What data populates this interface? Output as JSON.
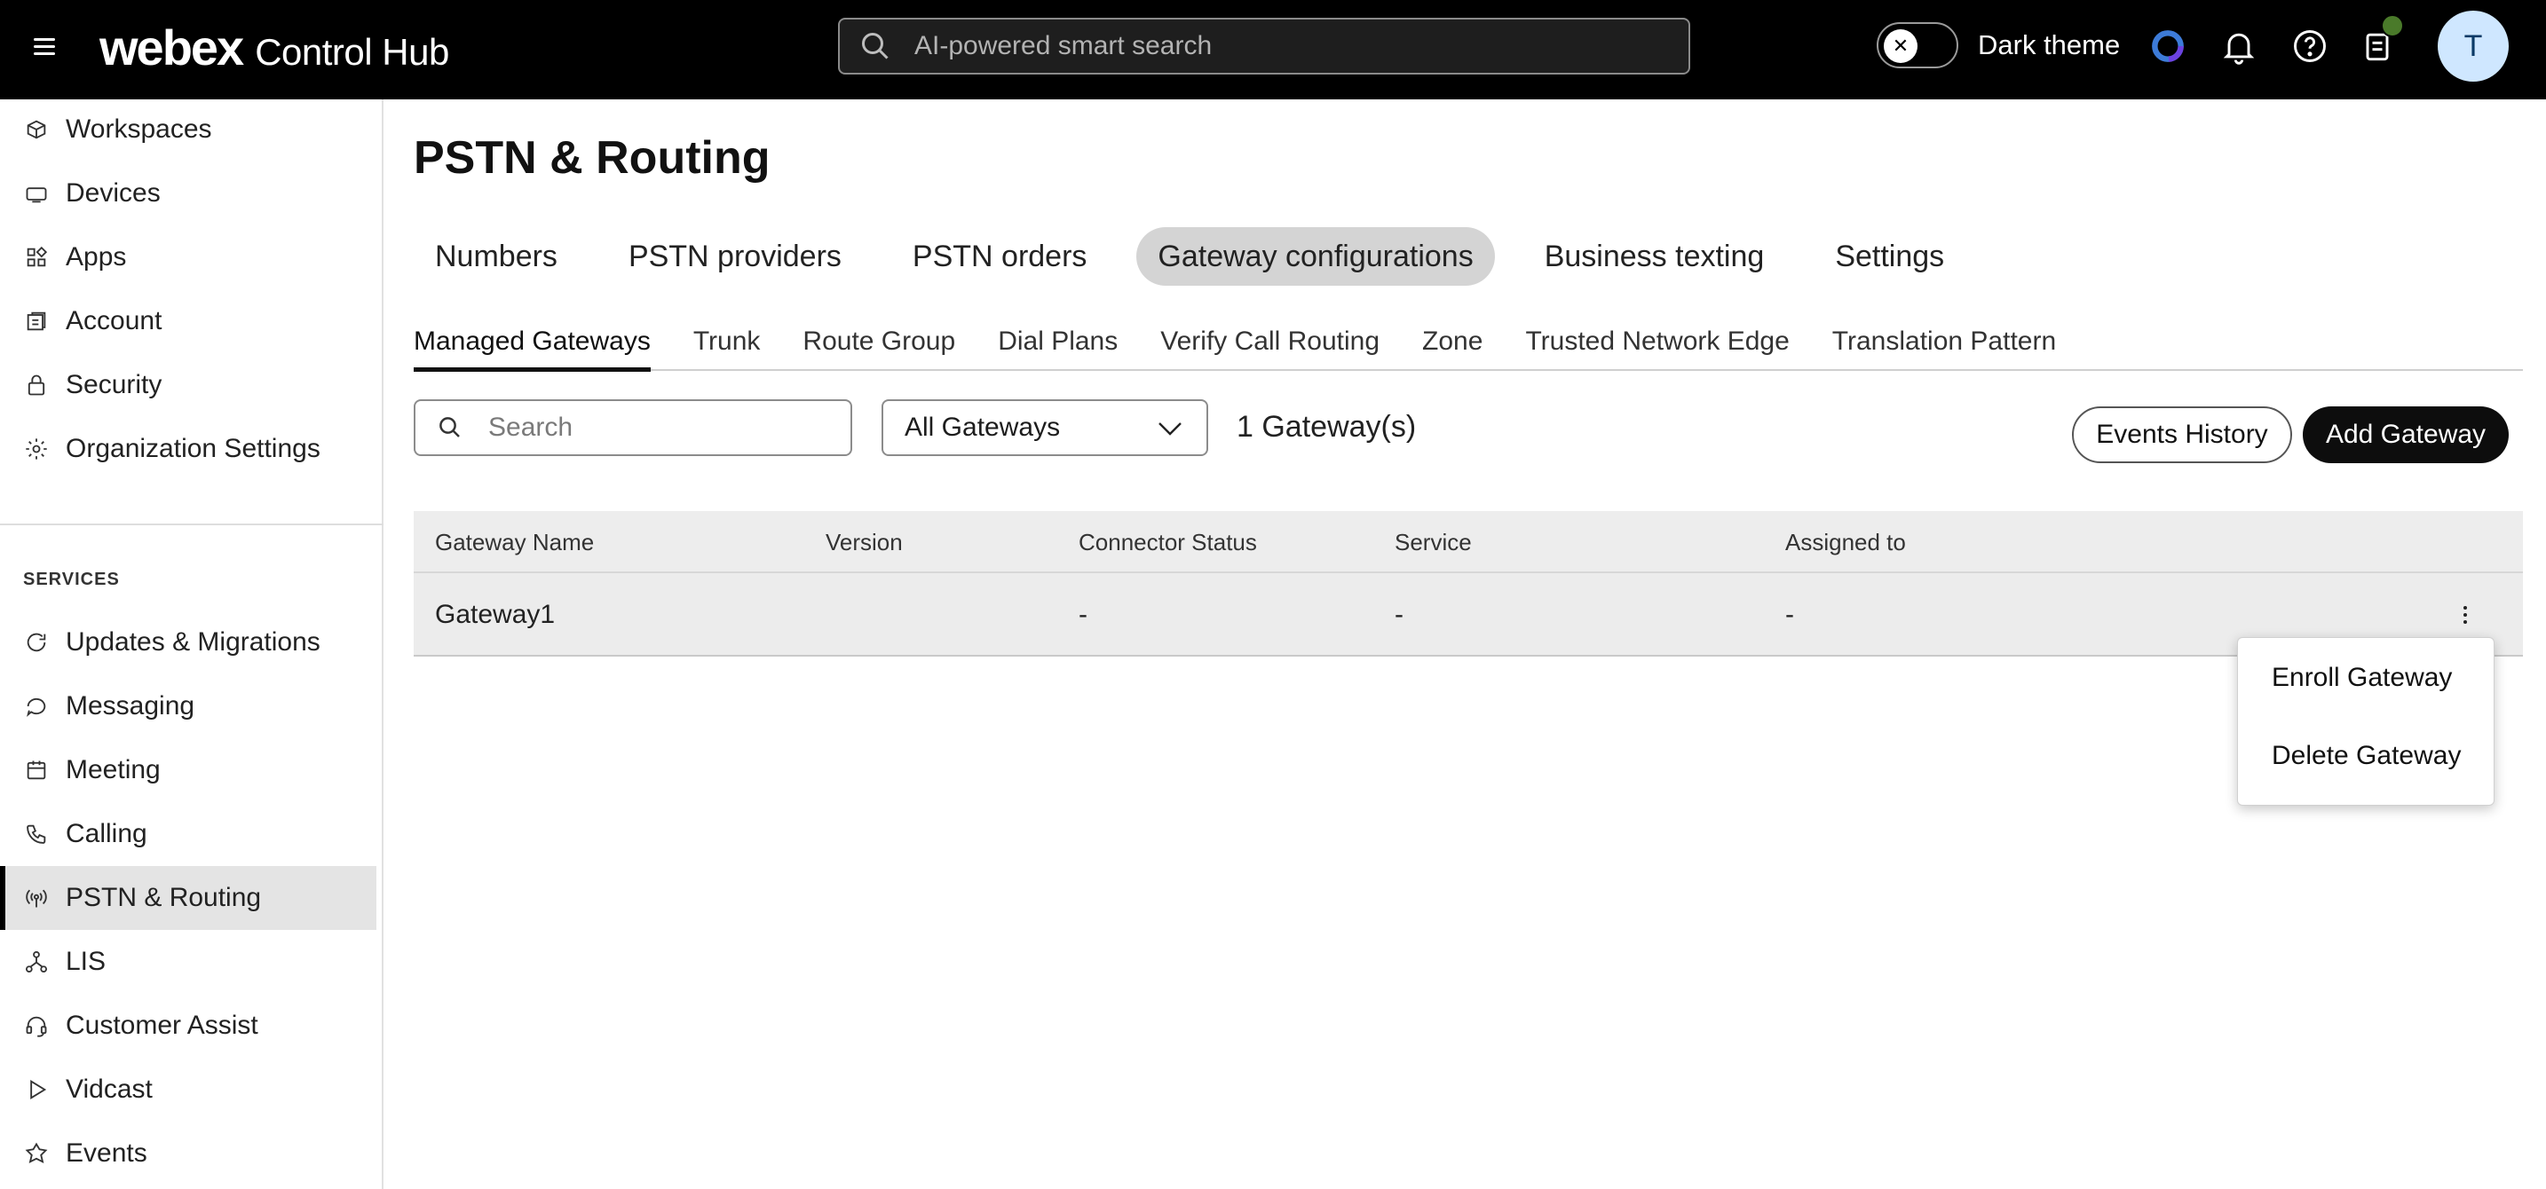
{
  "app": {
    "logo": "webex",
    "product": "Control Hub"
  },
  "header": {
    "search_placeholder": "AI-powered smart search",
    "theme_label": "Dark theme",
    "avatar_initial": "T",
    "icons": [
      "menu-icon",
      "search-icon",
      "toggle-close-icon",
      "webex-ai-icon",
      "bell-icon",
      "help-icon",
      "clipboard-icon"
    ]
  },
  "sidebar": {
    "items": [
      {
        "label": "Workspaces",
        "icon": "workspace-icon"
      },
      {
        "label": "Devices",
        "icon": "device-icon"
      },
      {
        "label": "Apps",
        "icon": "apps-icon"
      },
      {
        "label": "Account",
        "icon": "account-icon"
      },
      {
        "label": "Security",
        "icon": "lock-icon"
      },
      {
        "label": "Organization Settings",
        "icon": "gear-icon"
      }
    ],
    "section_label": "SERVICES",
    "services": [
      {
        "label": "Updates & Migrations",
        "icon": "refresh-icon"
      },
      {
        "label": "Messaging",
        "icon": "chat-icon"
      },
      {
        "label": "Meeting",
        "icon": "calendar-icon"
      },
      {
        "label": "Calling",
        "icon": "phone-icon"
      },
      {
        "label": "PSTN & Routing",
        "icon": "antenna-icon",
        "active": true
      },
      {
        "label": "LIS",
        "icon": "network-icon"
      },
      {
        "label": "Customer Assist",
        "icon": "headset-icon"
      },
      {
        "label": "Vidcast",
        "icon": "play-icon"
      },
      {
        "label": "Events",
        "icon": "events-icon"
      }
    ]
  },
  "main": {
    "title": "PSTN & Routing",
    "tabs": [
      {
        "label": "Numbers"
      },
      {
        "label": "PSTN providers"
      },
      {
        "label": "PSTN orders"
      },
      {
        "label": "Gateway configurations",
        "active": true
      },
      {
        "label": "Business texting"
      },
      {
        "label": "Settings"
      }
    ],
    "subtabs": [
      {
        "label": "Managed Gateways",
        "active": true
      },
      {
        "label": "Trunk"
      },
      {
        "label": "Route Group"
      },
      {
        "label": "Dial Plans"
      },
      {
        "label": "Verify Call Routing"
      },
      {
        "label": "Zone"
      },
      {
        "label": "Trusted Network Edge"
      },
      {
        "label": "Translation Pattern"
      }
    ],
    "search_placeholder": "Search",
    "filter_selected": "All Gateways",
    "count_text": "1 Gateway(s)",
    "events_history_label": "Events History",
    "add_gateway_label": "Add Gateway",
    "table": {
      "headers": [
        "Gateway Name",
        "Version",
        "Connector Status",
        "Service",
        "Assigned to"
      ],
      "rows": [
        [
          "Gateway1",
          "",
          "-",
          "-",
          "-"
        ]
      ]
    },
    "row_menu": {
      "items": [
        "Enroll Gateway",
        "Delete Gateway"
      ]
    }
  }
}
